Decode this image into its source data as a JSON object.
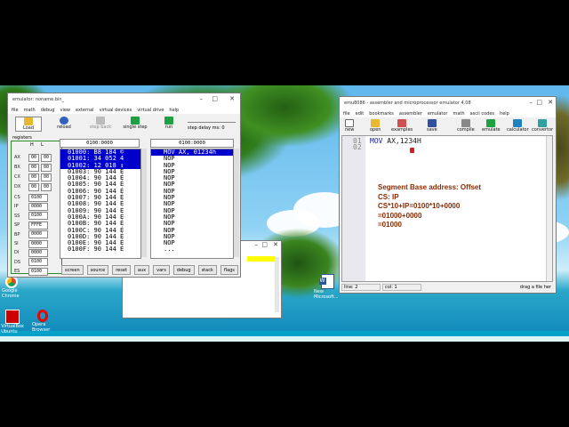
{
  "emulator": {
    "title": "emulator: noname.bin_",
    "menu": [
      "file",
      "math",
      "debug",
      "view",
      "external",
      "virtual devices",
      "virtual drive",
      "help"
    ],
    "toolbar": [
      "Load",
      "reload",
      "step back",
      "single step",
      "run"
    ],
    "step_delay": "step delay ms: 0",
    "registers_label": "registers",
    "hl": [
      "H",
      "L"
    ],
    "regs": [
      {
        "name": "AX",
        "h": "00",
        "l": "00"
      },
      {
        "name": "BX",
        "h": "00",
        "l": "00"
      },
      {
        "name": "CX",
        "h": "00",
        "l": "00"
      },
      {
        "name": "DX",
        "h": "00",
        "l": "00"
      }
    ],
    "seg_regs": [
      {
        "name": "CS",
        "v": "0100"
      },
      {
        "name": "IP",
        "v": "0000"
      },
      {
        "name": "SS",
        "v": "0100"
      },
      {
        "name": "SP",
        "v": "FFFE"
      },
      {
        "name": "BP",
        "v": "0000"
      },
      {
        "name": "SI",
        "v": "0000"
      },
      {
        "name": "DI",
        "v": "0000"
      },
      {
        "name": "DS",
        "v": "0100"
      },
      {
        "name": "ES",
        "v": "0100"
      }
    ],
    "mem_addr": "0100:0000",
    "dis_addr": "0100:0000",
    "memory": [
      "01000: B8 184 ©",
      "01001: 34 052 4",
      "01002: 12 018 ↕",
      "01003: 90 144 É",
      "01004: 90 144 É",
      "01005: 90 144 É",
      "01006: 90 144 É",
      "01007: 90 144 É",
      "01008: 90 144 É",
      "01009: 90 144 É",
      "0100A: 90 144 É",
      "0100B: 90 144 É",
      "0100C: 90 144 É",
      "0100D: 90 144 É",
      "0100E: 90 144 É",
      "0100F: 90 144 É"
    ],
    "disasm": [
      "MOV AX, 01234h",
      "NOP",
      "NOP",
      "NOP",
      "NOP",
      "NOP",
      "NOP",
      "NOP",
      "NOP",
      "NOP",
      "NOP",
      "NOP",
      "NOP",
      "NOP",
      "NOP",
      "..."
    ],
    "bottom_buttons": [
      "screen",
      "source",
      "reset",
      "aux",
      "vars",
      "debug",
      "stack",
      "flags"
    ]
  },
  "editor": {
    "title": "emu8086 - assembler and microprocessor emulator 4.08",
    "menu": [
      "file",
      "edit",
      "bookmarks",
      "assembler",
      "emulator",
      "math",
      "ascii codes",
      "help"
    ],
    "toolbar": [
      "new",
      "open",
      "examples",
      "save",
      "compile",
      "emulate",
      "calculator",
      "convertor"
    ],
    "line_numbers": [
      "01",
      "02"
    ],
    "code_mnemonic": "MOV",
    "code_operand": "AX,1234H",
    "notes": [
      "Segment Base address: Offset",
      "CS: IP",
      "CS*10+IP=0100*10+0000",
      "=01000+0000",
      "=01000"
    ],
    "status_line": "line: 2",
    "status_col": "col: 1",
    "status_drag": "drag a file her"
  },
  "desktop_icons": [
    "Google Chrome",
    "VirtualBox Ubuntu",
    "Opera Browser",
    "New Microsoft..."
  ]
}
